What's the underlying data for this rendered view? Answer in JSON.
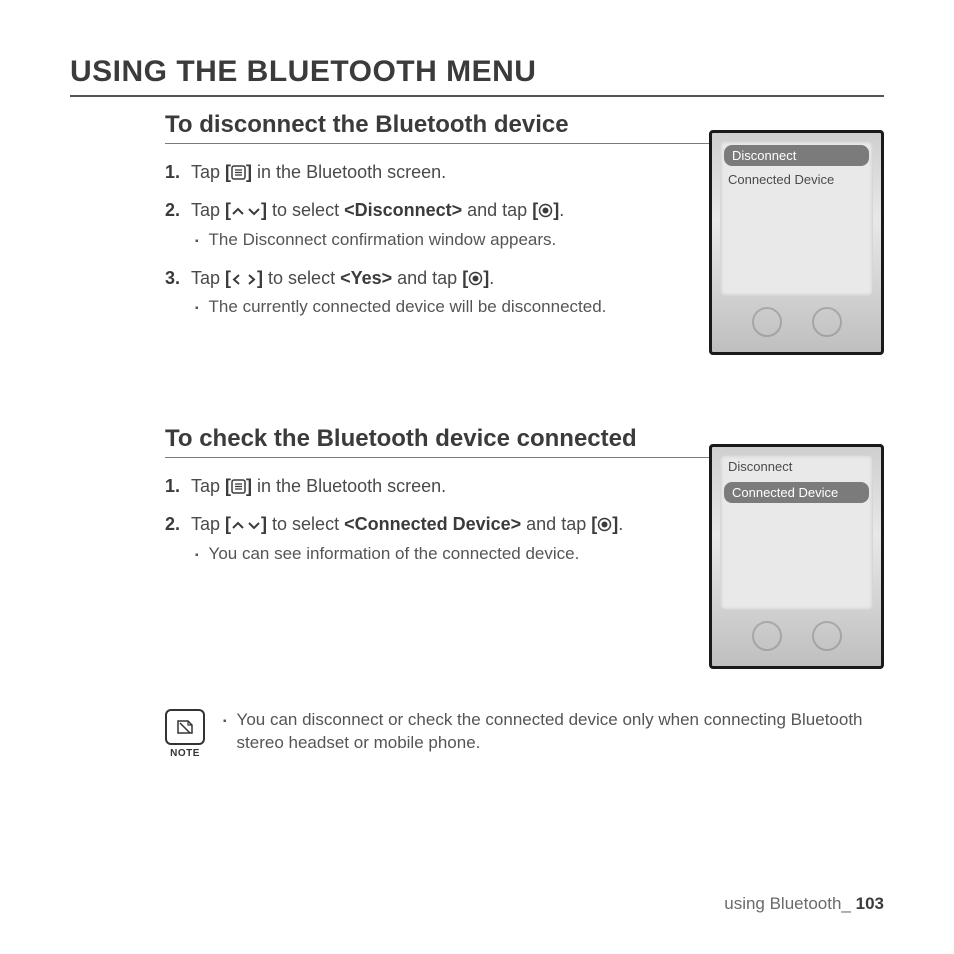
{
  "title": "USING THE BLUETOOTH MENU",
  "section1": {
    "heading": "To disconnect the Bluetooth device",
    "steps": [
      {
        "num": "1.",
        "pre": "Tap ",
        "post": " in the Bluetooth screen.",
        "icon": "menu"
      },
      {
        "num": "2.",
        "pre": "Tap ",
        "mid1": " to select ",
        "bold": "<Disconnect>",
        "mid2": " and tap ",
        "post": ".",
        "icon1": "updown",
        "icon2": "target",
        "sub": "The Disconnect confirmation window appears."
      },
      {
        "num": "3.",
        "pre": "Tap ",
        "mid1": " to select ",
        "bold": "<Yes>",
        "mid2": " and tap ",
        "post": ".",
        "icon1": "leftright",
        "icon2": "target",
        "sub": "The currently connected device will be disconnected."
      }
    ],
    "device": {
      "items": [
        "Disconnect",
        "Connected Device"
      ],
      "selected": 0
    }
  },
  "section2": {
    "heading": "To check the Bluetooth device connected",
    "steps": [
      {
        "num": "1.",
        "pre": "Tap ",
        "post": " in the Bluetooth screen.",
        "icon": "menu"
      },
      {
        "num": "2.",
        "pre": "Tap ",
        "mid1": " to select ",
        "bold": "<Connected Device>",
        "mid2": " and tap ",
        "post": ".",
        "icon1": "updown",
        "icon2": "target",
        "sub": "You can see information of the connected device."
      }
    ],
    "device": {
      "items": [
        "Disconnect",
        "Connected  Device"
      ],
      "selected": 1
    }
  },
  "note": {
    "label": "NOTE",
    "text": "You can disconnect or check the connected device only when connecting Bluetooth stereo headset or mobile phone."
  },
  "footer": {
    "text": "using Bluetooth_ ",
    "page": "103"
  },
  "icons": {
    "bracket_open": "[",
    "bracket_close": "]"
  }
}
